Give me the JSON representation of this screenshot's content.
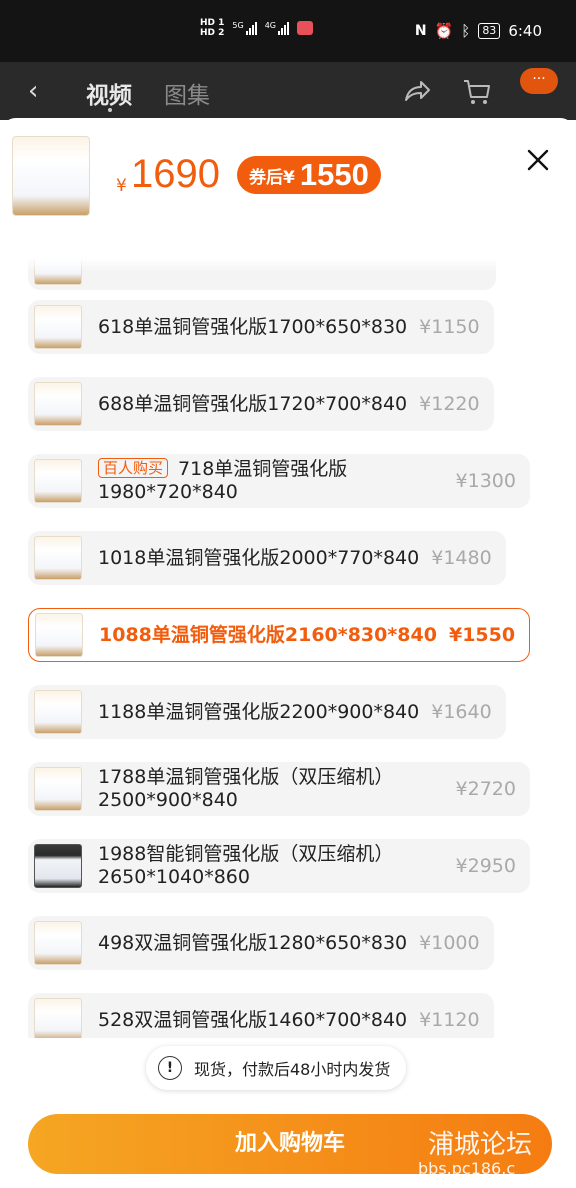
{
  "status": {
    "time": "6:40",
    "battery": "83",
    "sim1": "HD 1",
    "sim2": "HD 2",
    "net1": "5G",
    "net2": "4G"
  },
  "nav": {
    "back": "‹",
    "tab_video": "视频",
    "tab_gallery": "图集",
    "more": "···"
  },
  "product": {
    "yen": "¥",
    "price": "1690",
    "coupon_label": "券后¥",
    "coupon_price": "1550",
    "close_icon": "close-icon"
  },
  "options": [
    {
      "label": "618单温铜管强化版1700*650*830",
      "price": "¥1150",
      "selected": false
    },
    {
      "label": "688单温铜管强化版1720*700*840",
      "price": "¥1220",
      "selected": false
    },
    {
      "badge": "百人购买",
      "label": "718单温铜管强化版",
      "label2": "1980*720*840",
      "price": "¥1300",
      "selected": false
    },
    {
      "label": "1018单温铜管强化版2000*770*840",
      "price": "¥1480",
      "selected": false
    },
    {
      "label": "1088单温铜管强化版2160*830*840",
      "price": "¥1550",
      "selected": true
    },
    {
      "label": "1188单温铜管强化版2200*900*840",
      "price": "¥1640",
      "selected": false
    },
    {
      "label": "1788单温铜管强化版（双压缩机）",
      "label2": "2500*900*840",
      "price": "¥2720",
      "selected": false
    },
    {
      "label": "1988智能铜管强化版（双压缩机）",
      "label2": "2650*1040*860",
      "price": "¥2950",
      "selected": false
    },
    {
      "label": "498双温铜管强化版1280*650*830",
      "price": "¥1000",
      "selected": false
    },
    {
      "label": "528双温铜管强化版1460*700*840",
      "price": "¥1120",
      "selected": false
    }
  ],
  "notice": {
    "icon": "!",
    "text": "现货，付款后48小时内发货"
  },
  "cart_button": "加入购物车",
  "watermark": {
    "cn": "浦城论坛",
    "url": "bbs.pc186.c"
  },
  "colors": {
    "accent": "#f25c0d",
    "button_start": "#f5a623",
    "button_end": "#f57c12",
    "header_bg": "#2a2a2a"
  }
}
